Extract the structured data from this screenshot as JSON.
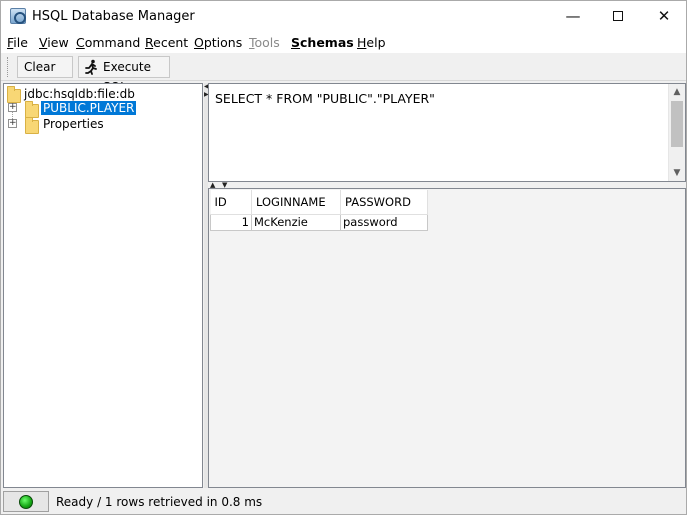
{
  "window": {
    "title": "HSQL Database Manager"
  },
  "window_controls": {
    "minimize": "—",
    "close": "✕"
  },
  "menu": [
    {
      "label": "File",
      "hotkey": "F",
      "rest": "ile",
      "enabled": true
    },
    {
      "label": "View",
      "hotkey": "V",
      "rest": "iew",
      "enabled": true
    },
    {
      "label": "Command",
      "hotkey": "C",
      "rest": "ommand",
      "enabled": true
    },
    {
      "label": "Recent",
      "hotkey": "R",
      "rest": "ecent",
      "enabled": true
    },
    {
      "label": "Options",
      "hotkey": "O",
      "rest": "ptions",
      "enabled": true
    },
    {
      "label": "Tools",
      "hotkey": "T",
      "rest": "ools",
      "enabled": false
    },
    {
      "label": "Schemas",
      "hotkey": "S",
      "rest": "chemas",
      "enabled": true
    },
    {
      "label": "Help",
      "hotkey": "H",
      "rest": "elp",
      "enabled": true
    }
  ],
  "toolbar": {
    "clear_label": "Clear ...",
    "execute_label": "Execute SQL"
  },
  "tree": {
    "root": "jdbc:hsqldb:file:db",
    "children": [
      {
        "label": "PUBLIC.PLAYER",
        "selected": true
      },
      {
        "label": "Properties",
        "selected": false
      }
    ]
  },
  "sql_editor": {
    "text": "SELECT * FROM \"PUBLIC\".\"PLAYER\""
  },
  "results": {
    "columns": [
      "ID",
      "LOGINNAME",
      "PASSWORD"
    ],
    "rows": [
      [
        "1",
        "McKenzie",
        "password"
      ]
    ]
  },
  "status": {
    "text": "Ready / 1 rows retrieved in 0.8 ms",
    "indicator_color": "#14a514"
  },
  "colors": {
    "selection": "#0078d7",
    "folder": "#f8d775"
  }
}
